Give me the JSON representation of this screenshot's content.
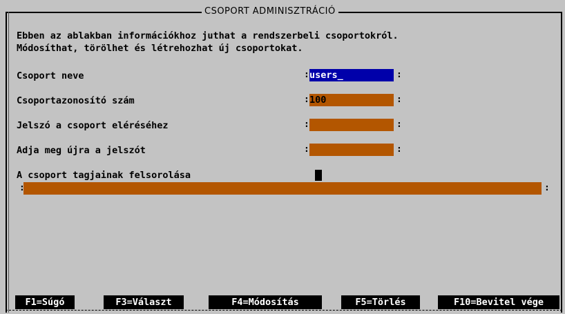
{
  "window": {
    "title": "CSOPORT ADMINISZTRÁCIÓ"
  },
  "intro": {
    "line1": "Ebben az ablakban információkhoz juthat a rendszerbeli csoportokról.",
    "line2": "Módosíthat, törölhet és létrehozhat új csoportokat."
  },
  "form": {
    "group_name": {
      "label": "Csoport neve",
      "value": "users_"
    },
    "group_id": {
      "label": "Csoportazonosító szám",
      "value": "100"
    },
    "password": {
      "label": "Jelszó a csoport eléréséhez",
      "value": ""
    },
    "password_confirm": {
      "label": "Adja meg újra a jelszót",
      "value": ""
    },
    "members": {
      "label": "A csoport tagjainak felsorolása",
      "value": ""
    }
  },
  "function_keys": [
    {
      "label": "F1=Súgó"
    },
    {
      "label": "F3=Választ"
    },
    {
      "label": "F4=Módosítás"
    },
    {
      "label": "F5=Törlés"
    },
    {
      "label": "F10=Bevitel vége"
    }
  ],
  "colors": {
    "background": "#c3c3c3",
    "field": "#b35600",
    "active_field": "#0000aa",
    "fkey_bar": "#000000"
  }
}
